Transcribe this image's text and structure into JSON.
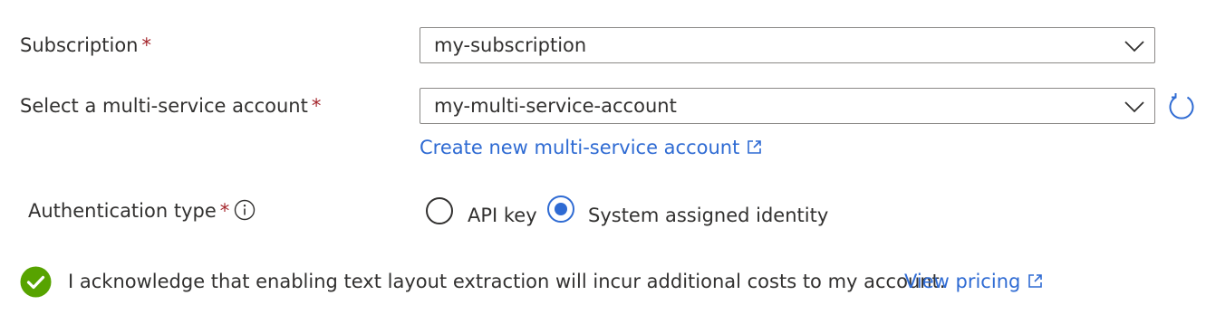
{
  "subscription": {
    "label": "Subscription",
    "required_mark": "*",
    "value": "my-subscription",
    "icon": "chevron-down-icon"
  },
  "account": {
    "label": "Select a multi-service account",
    "required_mark": "*",
    "value": "my-multi-service-account",
    "icon": "chevron-down-icon",
    "refresh_icon": "refresh-icon",
    "create_link": "Create new multi-service account",
    "create_link_icon": "external-link-icon"
  },
  "auth": {
    "label": "Authentication type",
    "required_mark": "*",
    "info_icon": "info-icon",
    "options": [
      {
        "label": "API key",
        "selected": false
      },
      {
        "label": "System assigned identity",
        "selected": true
      }
    ]
  },
  "acknowledge": {
    "icon": "checkmark-circle-icon",
    "text": "I acknowledge that enabling text layout extraction will incur additional costs to my account.",
    "link": "View pricing",
    "link_icon": "external-link-icon"
  },
  "colors": {
    "accent": "#2f6bd3",
    "required": "#a4262c",
    "success": "#57a300",
    "text": "#323130",
    "border": "#8a8886"
  }
}
